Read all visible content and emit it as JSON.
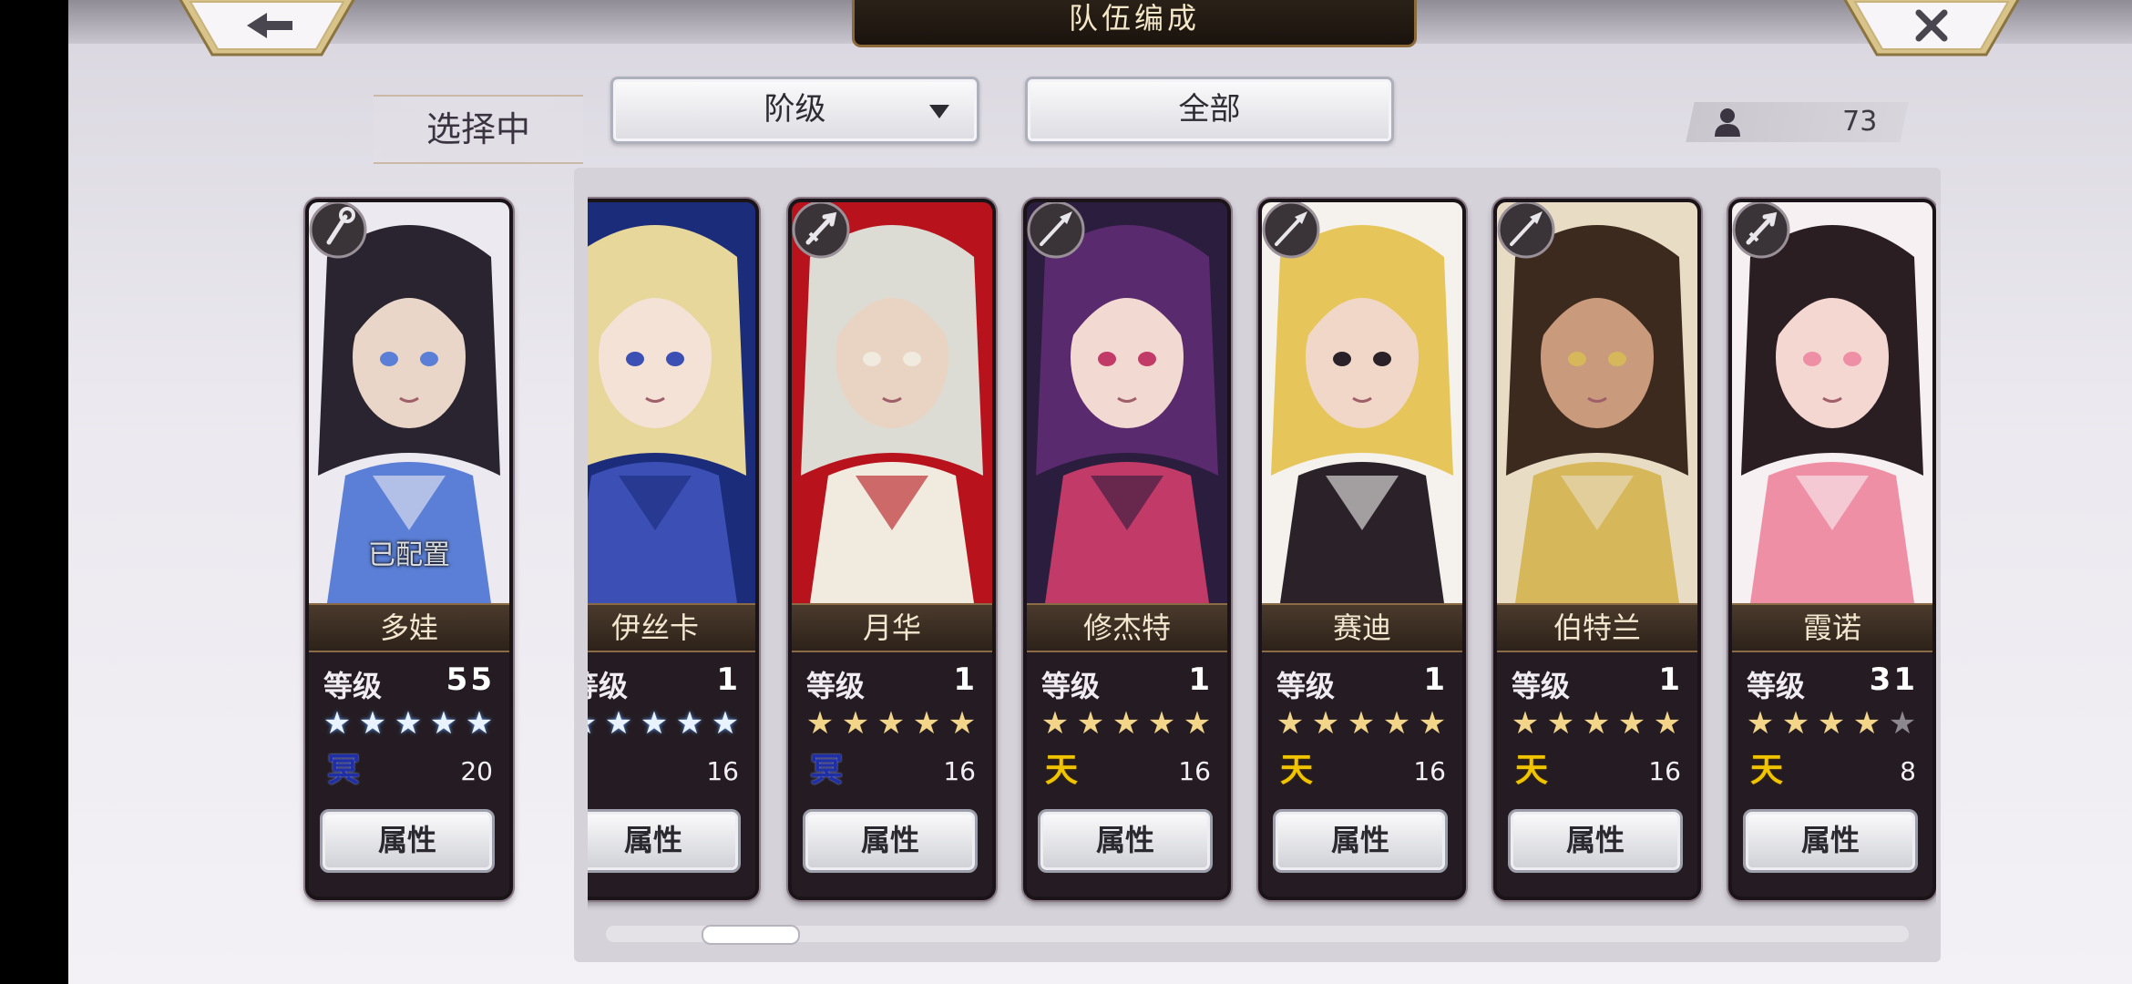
{
  "header": {
    "title": "队伍编成",
    "back_icon": "arrow-left-icon",
    "close_icon": "close-icon"
  },
  "selected_tab": {
    "label": "选择中"
  },
  "filters": {
    "rank_label": "阶级",
    "all_label": "全部"
  },
  "unit_count": {
    "icon": "person-icon",
    "value": "73"
  },
  "colors": {
    "star_blue": "#e8f3ff",
    "star_gold": "#f3d58a",
    "star_empty": "#8d8890",
    "elem_blue": "#1f2fa8",
    "elem_gold": "#f0c500"
  },
  "selected_card": {
    "name": "多娃",
    "level_label": "等级",
    "level": "55",
    "stars": [
      1,
      1,
      1,
      1,
      1
    ],
    "star_color": "blue",
    "element": "冥",
    "element_color": "blue",
    "cost": "20",
    "attr_label": "属性",
    "overlay": "已配置",
    "class_icon": "staff-icon",
    "palette": [
      "#eceaf0",
      "#2a2430",
      "#5b7fd6",
      "#e9d6c8"
    ]
  },
  "cards": [
    {
      "name": "伊丝卡",
      "level_label": "等级",
      "level": "1",
      "stars": [
        1,
        1,
        1,
        1,
        1
      ],
      "star_color": "blue",
      "element": "",
      "element_color": "blue",
      "cost": "16",
      "attr_label": "属性",
      "class_icon": "",
      "palette": [
        "#1b2c7a",
        "#e8d79a",
        "#3b4fb5",
        "#f3e2d5"
      ]
    },
    {
      "name": "月华",
      "level_label": "等级",
      "level": "1",
      "stars": [
        1,
        1,
        1,
        1,
        1
      ],
      "star_color": "gold",
      "element": "冥",
      "element_color": "blue",
      "cost": "16",
      "attr_label": "属性",
      "class_icon": "sword-icon",
      "palette": [
        "#b8121c",
        "#dcdcd4",
        "#f0eadf",
        "#e9d4c3"
      ]
    },
    {
      "name": "修杰特",
      "level_label": "等级",
      "level": "1",
      "stars": [
        1,
        1,
        1,
        1,
        1
      ],
      "star_color": "gold",
      "element": "天",
      "element_color": "gold",
      "cost": "16",
      "attr_label": "属性",
      "class_icon": "spear-icon",
      "palette": [
        "#2b1d3d",
        "#5a2a6e",
        "#c23a68",
        "#f2d9d1"
      ]
    },
    {
      "name": "赛迪",
      "level_label": "等级",
      "level": "1",
      "stars": [
        1,
        1,
        1,
        1,
        1
      ],
      "star_color": "gold",
      "element": "天",
      "element_color": "gold",
      "cost": "16",
      "attr_label": "属性",
      "class_icon": "spear-icon",
      "palette": [
        "#f5f2ee",
        "#e6c65a",
        "#2a2228",
        "#f0d7c8"
      ]
    },
    {
      "name": "伯特兰",
      "level_label": "等级",
      "level": "1",
      "stars": [
        1,
        1,
        1,
        1,
        1
      ],
      "star_color": "gold",
      "element": "天",
      "element_color": "gold",
      "cost": "16",
      "attr_label": "属性",
      "class_icon": "spear-icon",
      "palette": [
        "#e9dcc5",
        "#3d2a1f",
        "#d6b85a",
        "#c99a7c"
      ]
    },
    {
      "name": "霞诺",
      "level_label": "等级",
      "level": "31",
      "stars": [
        1,
        1,
        1,
        1,
        0
      ],
      "star_color": "gold",
      "element": "天",
      "element_color": "gold",
      "cost": "8",
      "attr_label": "属性",
      "class_icon": "sword-icon",
      "palette": [
        "#f6f0f2",
        "#2a1e22",
        "#ef8fa6",
        "#f3d7d0"
      ]
    }
  ]
}
